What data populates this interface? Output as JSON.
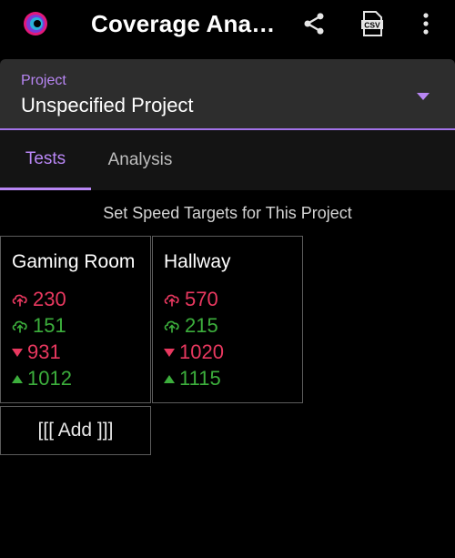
{
  "app": {
    "title": "Coverage Ana…",
    "actions": [
      {
        "name": "share-icon"
      },
      {
        "name": "csv-icon",
        "label": "CSV"
      },
      {
        "name": "more-vert-icon"
      }
    ]
  },
  "project": {
    "label": "Project",
    "value": "Unspecified Project"
  },
  "tabs": [
    {
      "label": "Tests",
      "selected": true
    },
    {
      "label": "Analysis",
      "selected": false
    }
  ],
  "subtitle": "Set Speed Targets for This Project",
  "cards": [
    {
      "name": "Gaming Room",
      "metrics": [
        {
          "icon": "cloud-upload-icon",
          "value": "230",
          "color": "#e8385f"
        },
        {
          "icon": "cloud-upload-icon",
          "value": "151",
          "color": "#3cae3c"
        },
        {
          "icon": "triangle-down-icon",
          "value": "931",
          "color": "#e8385f"
        },
        {
          "icon": "triangle-up-icon",
          "value": "1012",
          "color": "#3cae3c"
        }
      ]
    },
    {
      "name": "Hallway",
      "metrics": [
        {
          "icon": "cloud-upload-icon",
          "value": "570",
          "color": "#e8385f"
        },
        {
          "icon": "cloud-upload-icon",
          "value": "215",
          "color": "#3cae3c"
        },
        {
          "icon": "triangle-down-icon",
          "value": "1020",
          "color": "#e8385f"
        },
        {
          "icon": "triangle-up-icon",
          "value": "1115",
          "color": "#3cae3c"
        }
      ]
    }
  ],
  "add_label": "[[[ Add ]]]",
  "colors": {
    "accent": "#b886f4",
    "bad": "#e8385f",
    "good": "#3cae3c"
  }
}
